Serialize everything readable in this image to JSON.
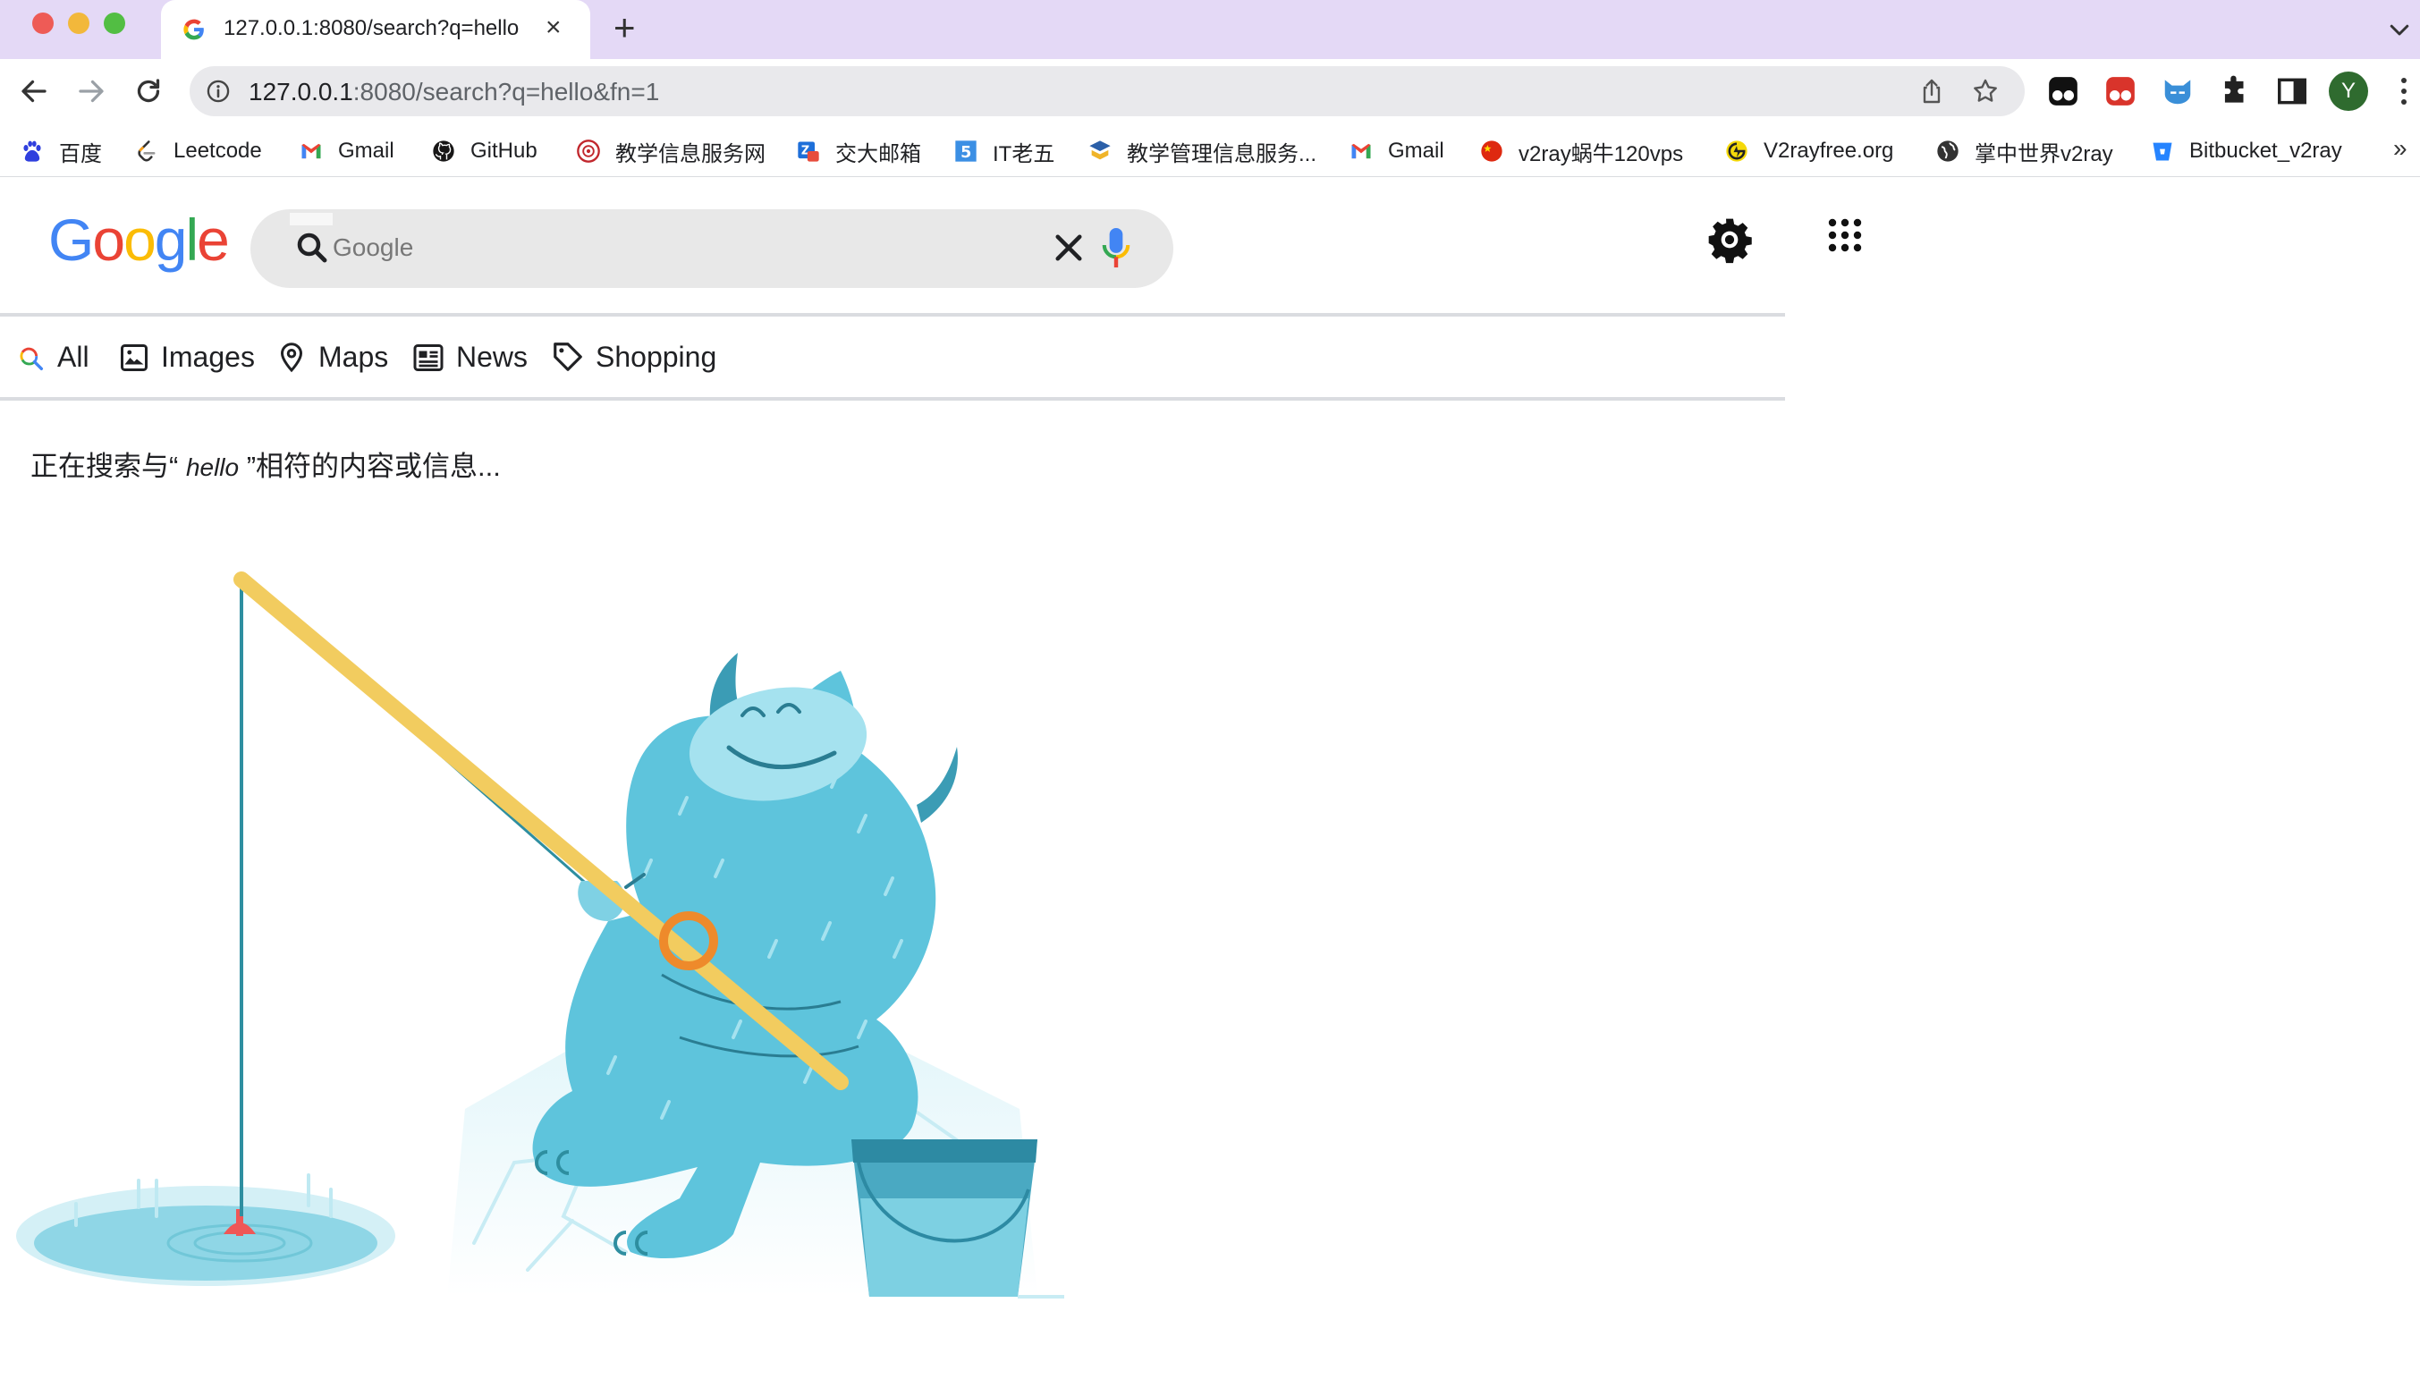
{
  "browser": {
    "tab": {
      "title": "127.0.0.1:8080/search?q=hello&fn=1",
      "close": "×"
    },
    "new_tab": "+",
    "url": {
      "host": "127.0.0.1",
      "rest": ":8080/search?q=hello&fn=1"
    },
    "profile_initial": "Y",
    "bookmarks_overflow": "»",
    "bookmarks": [
      {
        "label": "百度",
        "icon": "baidu-icon",
        "color": "#2f3fde"
      },
      {
        "label": "Leetcode",
        "icon": "leetcode-icon",
        "color": "#f89f1b"
      },
      {
        "label": "Gmail",
        "icon": "gmail-icon",
        "color": "#ea4335"
      },
      {
        "label": "GitHub",
        "icon": "github-icon",
        "color": "#181717"
      },
      {
        "label": "教学信息服务网",
        "icon": "university-icon",
        "color": "#c1272d"
      },
      {
        "label": "交大邮箱",
        "icon": "mail-icon",
        "color": "#1e6fd9"
      },
      {
        "label": "IT老五",
        "icon": "itlaowu-icon",
        "color": "#3b8fe4"
      },
      {
        "label": "教学管理信息服务...",
        "icon": "academic-icon",
        "color": "#2b5fa8"
      },
      {
        "label": "Gmail",
        "icon": "gmail-icon",
        "color": "#ea4335"
      },
      {
        "label": "v2ray蜗牛120vps",
        "icon": "v2ray-cn-icon",
        "color": "#de2910"
      },
      {
        "label": "V2rayfree.org",
        "icon": "v2rayfree-icon",
        "color": "#e8c300"
      },
      {
        "label": "掌中世界v2ray",
        "icon": "globe-icon",
        "color": "#333333"
      },
      {
        "label": "Bitbucket_v2ray",
        "icon": "bitbucket-icon",
        "color": "#2684ff"
      }
    ]
  },
  "page": {
    "logo": "Google",
    "search": {
      "placeholder": "Google",
      "value": ""
    },
    "nav_tabs": [
      {
        "label": "All",
        "icon": "search-icon"
      },
      {
        "label": "Images",
        "icon": "image-icon"
      },
      {
        "label": "Maps",
        "icon": "map-pin-icon"
      },
      {
        "label": "News",
        "icon": "newspaper-icon"
      },
      {
        "label": "Shopping",
        "icon": "tag-icon"
      }
    ],
    "status": {
      "prefix": "正在搜索与“ ",
      "query": "hello",
      "suffix": " ”相符的内容或信息..."
    },
    "illustration": "fishing-monster-illustration"
  },
  "colors": {
    "tabstrip": "#e4d9f6",
    "google_blue": "#4285f4",
    "google_red": "#ea4335",
    "google_yellow": "#fbbc05",
    "google_green": "#34a853",
    "monster": "#5ec4dc"
  }
}
